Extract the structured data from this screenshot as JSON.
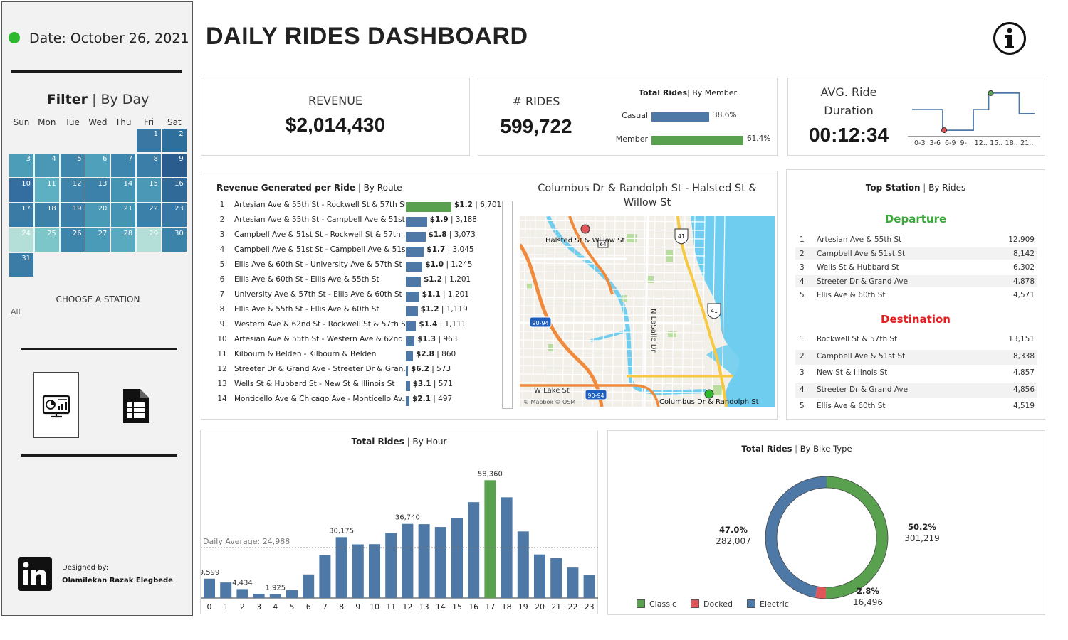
{
  "sidebar": {
    "date_label": "Date: October 26, 2021",
    "filter_title": "Filter",
    "filter_sub": "By Day",
    "days_of_week": [
      "Sun",
      "Mon",
      "Tue",
      "Wed",
      "Thu",
      "Fri",
      "Sat"
    ],
    "calendar_days": [
      "1",
      "2",
      "3",
      "4",
      "5",
      "6",
      "7",
      "8",
      "9",
      "10",
      "11",
      "12",
      "13",
      "14",
      "15",
      "16",
      "17",
      "18",
      "19",
      "20",
      "21",
      "22",
      "23",
      "24",
      "25",
      "26",
      "27",
      "28",
      "29",
      "30",
      "31"
    ],
    "calendar_colors": [
      "#3a78a3",
      "#2f6f9c",
      "#4c9db8",
      "#4a98b6",
      "#3f87ad",
      "#4fa0ba",
      "#3e86ad",
      "#3b7fa8",
      "#2a5c8e",
      "#346ea0",
      "#5db0c2",
      "#3d83aa",
      "#3b81a9",
      "#4694b4",
      "#4a97b6",
      "#2f6a98",
      "#3a7ba5",
      "#3d80a8",
      "#3c7fa8",
      "#4a99b7",
      "#4594b3",
      "#3b80a9",
      "#3977a4",
      "#b4dfd8",
      "#7cc6ca",
      "#3d85ab",
      "#4a9bb7",
      "#59aabf",
      "#b4dfd8",
      "#3c83aa",
      "#3b7ca7"
    ],
    "choose_station_title": "CHOOSE A STATION",
    "choose_station_value": "All",
    "designed_by_label": "Designed by:",
    "designer_name": "Olamilekan Razak Elegbede"
  },
  "header": {
    "title": "DAILY RIDES DASHBOARD"
  },
  "revenue": {
    "label": "REVENUE",
    "value": "$2,014,430"
  },
  "rides": {
    "label": "# RIDES",
    "value": "599,722",
    "chart_title": "Total Rides",
    "chart_sub": "By Member",
    "members": [
      {
        "name": "Casual",
        "pct_label": "38.6%",
        "pct": 38.6,
        "color": "#4e79a7"
      },
      {
        "name": "Member",
        "pct_label": "61.4%",
        "pct": 61.4,
        "color": "#59a14f"
      }
    ]
  },
  "duration": {
    "label_line1": "AVG. Ride",
    "label_line2": "Duration",
    "value": "00:12:34",
    "ticks": [
      "0-3",
      "3-6",
      "6-9",
      "9-..",
      "12..",
      "15..",
      "18..",
      "21.."
    ],
    "step_levels": [
      0.55,
      0.55,
      0.05,
      0.05,
      0.55,
      0.95,
      0.95,
      0.45
    ],
    "min_color": "#e15759",
    "max_color": "#59a14f"
  },
  "routes": {
    "title": "Revenue Generated per Ride",
    "title_sub": "By Route",
    "items": [
      {
        "rank": "1",
        "name": "Artesian Ave & 55th St - Rockwell St & 57th St",
        "revenue_label": "$1.2",
        "revenue": 1.2,
        "rides_label": "6,701",
        "rides": 6701
      },
      {
        "rank": "2",
        "name": "Artesian Ave & 55th St - Campbell Ave & 51st..",
        "revenue_label": "$1.9",
        "revenue": 1.9,
        "rides_label": "3,188",
        "rides": 3188
      },
      {
        "rank": "3",
        "name": "Campbell Ave & 51st St - Rockwell St & 57th ..",
        "revenue_label": "$1.8",
        "revenue": 1.8,
        "rides_label": "3,073",
        "rides": 3073
      },
      {
        "rank": "4",
        "name": "Campbell Ave & 51st St - Campbell Ave & 51s..",
        "revenue_label": "$1.7",
        "revenue": 1.7,
        "rides_label": "3,045",
        "rides": 3045
      },
      {
        "rank": "5",
        "name": "Ellis Ave & 60th St - University Ave & 57th St",
        "revenue_label": "$1.0",
        "revenue": 1.0,
        "rides_label": "1,245",
        "rides": 1245
      },
      {
        "rank": "6",
        "name": "Ellis Ave & 60th St - Ellis Ave & 55th St",
        "revenue_label": "$1.2",
        "revenue": 1.2,
        "rides_label": "1,201",
        "rides": 1201
      },
      {
        "rank": "7",
        "name": "University Ave & 57th St - Ellis Ave & 60th St",
        "revenue_label": "$1.1",
        "revenue": 1.1,
        "rides_label": "1,201",
        "rides": 1201
      },
      {
        "rank": "8",
        "name": "Ellis Ave & 55th St - Ellis Ave & 60th St",
        "revenue_label": "$1.2",
        "revenue": 1.2,
        "rides_label": "1,119",
        "rides": 1119
      },
      {
        "rank": "9",
        "name": "Western Ave & 62nd St - Rockwell St & 57th St",
        "revenue_label": "$1.4",
        "revenue": 1.4,
        "rides_label": "1,111",
        "rides": 1111
      },
      {
        "rank": "10",
        "name": "Artesian Ave & 55th St - Western Ave & 62nd ..",
        "revenue_label": "$1.3",
        "revenue": 1.3,
        "rides_label": "963",
        "rides": 963
      },
      {
        "rank": "11",
        "name": "Kilbourn & Belden - Kilbourn & Belden",
        "revenue_label": "$2.8",
        "revenue": 2.8,
        "rides_label": "860",
        "rides": 860
      },
      {
        "rank": "12",
        "name": "Streeter Dr & Grand Ave - Streeter Dr & Gran..",
        "revenue_label": "$6.2",
        "revenue": 6.2,
        "rides_label": "573",
        "rides": 573
      },
      {
        "rank": "13",
        "name": "Wells St & Hubbard St - New St & Illinois St",
        "revenue_label": "$3.1",
        "revenue": 3.1,
        "rides_label": "571",
        "rides": 571
      },
      {
        "rank": "14",
        "name": "Monticello Ave & Chicago Ave - Monticello Av..",
        "revenue_label": "$2.1",
        "revenue": 2.1,
        "rides_label": "497",
        "rides": 497
      }
    ]
  },
  "map": {
    "title": "Columbus Dr & Randolph St - Halsted St & Willow St",
    "label_start": "Halsted St & Willow St",
    "label_end": "Columbus Dr & Randolph St",
    "label_wlake": "W Lake St",
    "label_lasalle": "N LaSalle Dr",
    "shield_41": "41",
    "shield_64": "64",
    "shield_9094": "90-94",
    "attribution": "© Mapbox © OSM",
    "water_color": "#6fcdf0",
    "land_color": "#f2efe9"
  },
  "top_station": {
    "title": "Top Station",
    "title_sub": "By Rides",
    "departure_title": "Departure",
    "departure": [
      {
        "rank": "1",
        "name": "Artesian Ave & 55th St",
        "value": "12,909"
      },
      {
        "rank": "2",
        "name": "Campbell Ave & 51st St",
        "value": "8,142"
      },
      {
        "rank": "3",
        "name": "Wells St & Hubbard St",
        "value": "6,302"
      },
      {
        "rank": "4",
        "name": "Streeter Dr & Grand Ave",
        "value": "4,878"
      },
      {
        "rank": "5",
        "name": "Ellis Ave & 60th St",
        "value": "4,571"
      }
    ],
    "destination_title": "Destination",
    "destination": [
      {
        "rank": "1",
        "name": "Rockwell St & 57th St",
        "value": "13,151"
      },
      {
        "rank": "2",
        "name": "Campbell Ave & 51st St",
        "value": "8,338"
      },
      {
        "rank": "3",
        "name": "New St & Illinois St",
        "value": "4,857"
      },
      {
        "rank": "4",
        "name": "Streeter Dr & Grand Ave",
        "value": "4,856"
      },
      {
        "rank": "5",
        "name": "Ellis Ave & 60th St",
        "value": "4,519"
      }
    ],
    "departure_color": "#3aa83a",
    "destination_color": "#e02020"
  },
  "chart_data": [
    {
      "type": "bar",
      "title": "Total Rides",
      "subtitle": "By Hour",
      "categories": [
        "0",
        "1",
        "2",
        "3",
        "4",
        "5",
        "6",
        "7",
        "8",
        "9",
        "10",
        "11",
        "12",
        "13",
        "14",
        "15",
        "16",
        "17",
        "18",
        "19",
        "20",
        "21",
        "22",
        "23"
      ],
      "values": [
        9599,
        7700,
        4434,
        2100,
        1925,
        4000,
        11700,
        21300,
        30175,
        26600,
        26700,
        32200,
        36740,
        36600,
        35200,
        39800,
        47500,
        58360,
        49900,
        33000,
        21600,
        19900,
        15100,
        11500
      ],
      "value_labels": [
        "9,599",
        "",
        "4,434",
        "",
        "1,925",
        "",
        "",
        "",
        "30,175",
        "",
        "",
        "",
        "36,740",
        "",
        "",
        "",
        "",
        "58,360",
        "",
        "",
        "",
        "",
        "",
        ""
      ],
      "reference_line": {
        "label": "Daily Average: 24,988",
        "value": 24988
      },
      "highlight_index": 17,
      "ylim": [
        0,
        62000
      ],
      "bar_color": "#4e79a7",
      "highlight_color": "#59a14f"
    },
    {
      "type": "pie",
      "title": "Total Rides",
      "subtitle": "By Bike Type",
      "series": [
        {
          "name": "Classic",
          "pct": 50.2,
          "pct_label": "50.2%",
          "value_label": "301,219",
          "color": "#59a14f"
        },
        {
          "name": "Docked",
          "pct": 2.8,
          "pct_label": "2.8%",
          "value_label": "16,496",
          "color": "#e15759"
        },
        {
          "name": "Electric",
          "pct": 47.0,
          "pct_label": "47.0%",
          "value_label": "282,007",
          "color": "#4e79a7"
        }
      ]
    }
  ]
}
